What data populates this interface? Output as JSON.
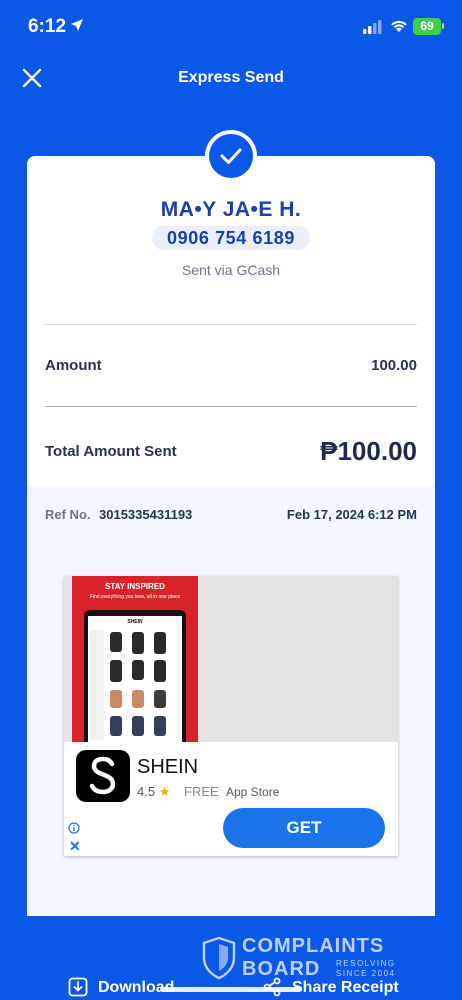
{
  "status_bar": {
    "time": "6:12",
    "battery": "69"
  },
  "header": {
    "title": "Express Send"
  },
  "recipient": {
    "name": "MA•Y JA•E H.",
    "phone": "0906 754 6189",
    "via": "Sent via GCash"
  },
  "amount": {
    "label": "Amount",
    "value": "100.00"
  },
  "total": {
    "label": "Total Amount Sent",
    "value": "₱100.00"
  },
  "reference": {
    "label": "Ref No.",
    "number": "3015335431193",
    "date": "Feb 17, 2024 6:12 PM"
  },
  "ad": {
    "banner_heading": "STAY INSPIRED",
    "banner_sub": "Find everything you love, all in one place",
    "tablet_logo": "SHEIN",
    "app_name": "SHEIN",
    "rating": "4.5",
    "price": "FREE",
    "store": "App Store",
    "cta": "GET"
  },
  "watermark": {
    "line1": "COMPLAINTS",
    "line2": "BOARD",
    "line3": "RESOLVING",
    "line4": "SINCE 2004"
  },
  "actions": {
    "download": "Download",
    "share": "Share Receipt"
  },
  "colors": {
    "brand_blue": "#0b57e6",
    "name_blue": "#1a3fa8",
    "get_button": "#1a73e8",
    "battery_green": "#3ecf4b"
  }
}
